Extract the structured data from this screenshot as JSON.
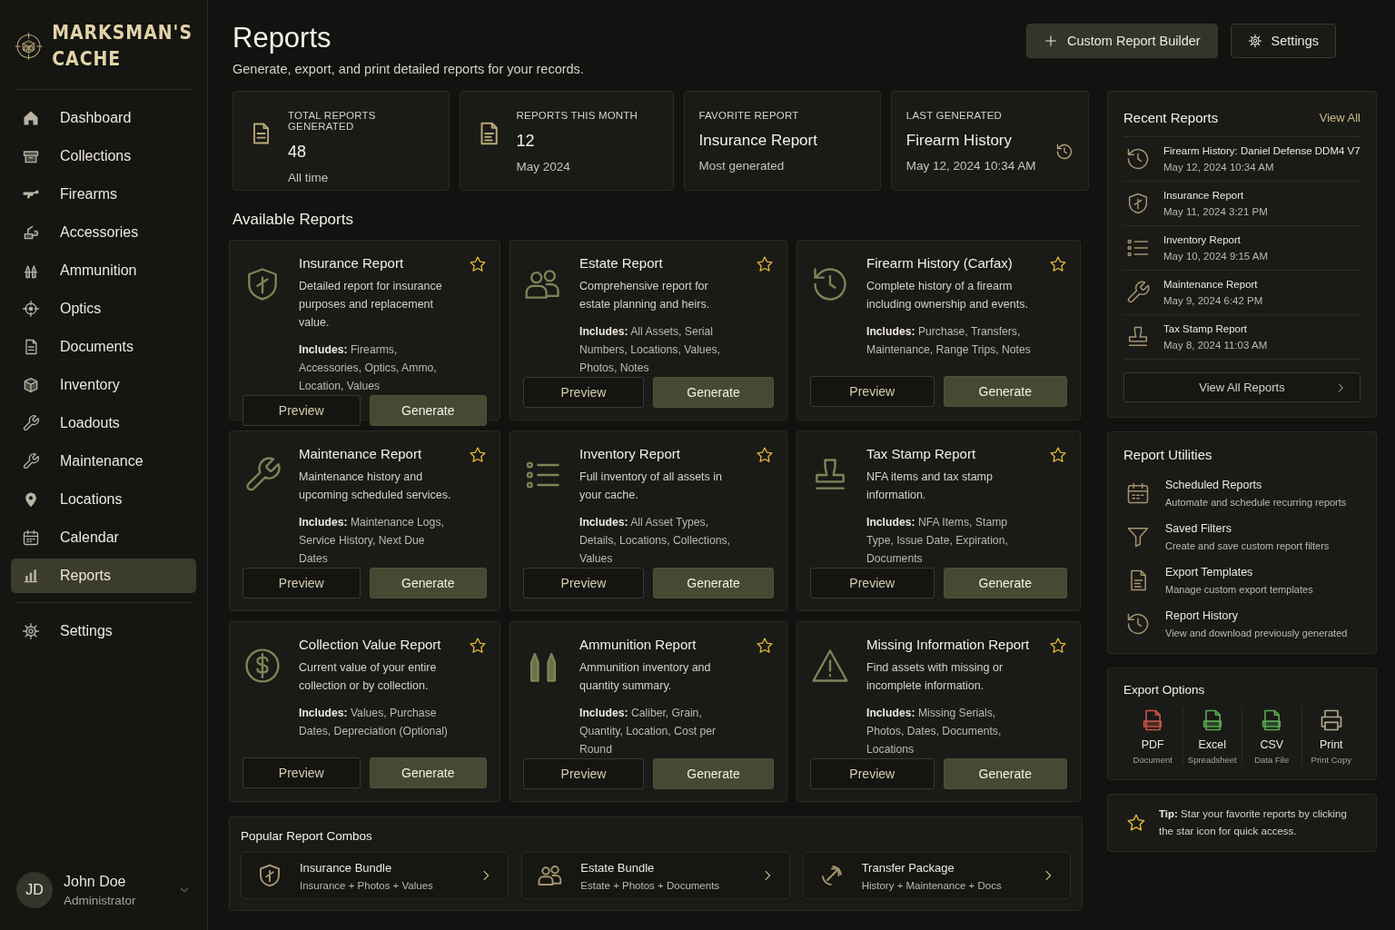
{
  "brand": {
    "line1": "MARKSMAN'S",
    "line2": "CACHE"
  },
  "nav": [
    {
      "label": "Dashboard",
      "selected": false
    },
    {
      "label": "Collections",
      "selected": false
    },
    {
      "label": "Firearms",
      "selected": false
    },
    {
      "label": "Accessories",
      "selected": false
    },
    {
      "label": "Ammunition",
      "selected": false
    },
    {
      "label": "Optics",
      "selected": false
    },
    {
      "label": "Documents",
      "selected": false
    },
    {
      "label": "Inventory",
      "selected": false
    },
    {
      "label": "Loadouts",
      "selected": false
    },
    {
      "label": "Maintenance",
      "selected": false
    },
    {
      "label": "Locations",
      "selected": false
    },
    {
      "label": "Calendar",
      "selected": false
    },
    {
      "label": "Reports",
      "selected": true
    }
  ],
  "nav_footer": [
    {
      "label": "Settings",
      "selected": false
    }
  ],
  "user": {
    "initials": "JD",
    "name": "John Doe",
    "role": "Administrator"
  },
  "header": {
    "title": "Reports",
    "subtitle": "Generate, export, and print detailed reports for your records.",
    "buttons": [
      "Custom Report Builder",
      "Settings"
    ]
  },
  "stats": [
    {
      "label": "TOTAL REPORTS GENERATED",
      "value": "48",
      "note": "All time"
    },
    {
      "label": "REPORTS THIS MONTH",
      "value": "12",
      "note": "May 2024"
    },
    {
      "label": "FAVORITE REPORT",
      "value": "Insurance Report",
      "note": "Most generated"
    },
    {
      "label": "LAST GENERATED",
      "value": "Firearm History",
      "note": "May 12, 2024 10:34 AM"
    }
  ],
  "available": {
    "title": "Available Reports",
    "reports": [
      {
        "title": "Insurance Report",
        "description": "Detailed report for insurance purposes and replacement value.",
        "includes": "**Includes:** Firearms, Accessories, Optics, Ammo, Location, Values",
        "actions": [
          "Preview",
          "Generate"
        ]
      },
      {
        "title": "Estate Report",
        "description": "Comprehensive report for estate planning and heirs.",
        "includes": "**Includes:** All Assets, Serial Numbers, Locations, Values, Photos, Notes",
        "actions": [
          "Preview",
          "Generate"
        ]
      },
      {
        "title": "Firearm History (Carfax)",
        "description": "Complete history of a firearm including ownership and events.",
        "includes": "**Includes:** Purchase, Transfers, Maintenance, Range Trips, Notes",
        "actions": [
          "Preview",
          "Generate"
        ]
      },
      {
        "title": "Maintenance Report",
        "description": "Maintenance history and upcoming scheduled services.",
        "includes": "**Includes:** Maintenance Logs, Service History, Next Due Dates",
        "actions": [
          "Preview",
          "Generate"
        ]
      },
      {
        "title": "Inventory Report",
        "description": "Full inventory of all assets in your cache.",
        "includes": "**Includes:** All Asset Types, Details, Locations, Collections, Values",
        "actions": [
          "Preview",
          "Generate"
        ]
      },
      {
        "title": "Tax Stamp Report",
        "description": "NFA items and tax stamp information.",
        "includes": "**Includes:** NFA Items, Stamp Type, Issue Date, Expiration, Documents",
        "actions": [
          "Preview",
          "Generate"
        ]
      },
      {
        "title": "Collection Value Report",
        "description": "Current value of your entire collection or by collection.",
        "includes": "**Includes:** Values, Purchase Dates, Depreciation (Optional)",
        "actions": [
          "Preview",
          "Generate"
        ]
      },
      {
        "title": "Ammunition Report",
        "description": "Ammunition inventory and quantity summary.",
        "includes": "**Includes:** Caliber, Grain, Quantity, Location, Cost per Round",
        "actions": [
          "Preview",
          "Generate"
        ]
      },
      {
        "title": "Missing Information Report",
        "description": "Find assets with missing or incomplete information.",
        "includes": "**Includes:** Missing Serials, Photos, Dates, Documents, Locations",
        "actions": [
          "Preview",
          "Generate"
        ]
      }
    ]
  },
  "combos": {
    "title": "Popular Report Combos",
    "items": [
      {
        "title": "Insurance Bundle",
        "subtitle": "Insurance + Photos + Values"
      },
      {
        "title": "Estate Bundle",
        "subtitle": "Estate + Photos + Documents"
      },
      {
        "title": "Transfer Package",
        "subtitle": "History + Maintenance + Docs"
      }
    ]
  },
  "recent": {
    "title": "Recent Reports",
    "link": "View All",
    "items": [
      {
        "title": "Firearm History: Daniel Defense DDM4 V7",
        "time": "May 12, 2024 10:34 AM"
      },
      {
        "title": "Insurance Report",
        "time": "May 11, 2024 3:21 PM"
      },
      {
        "title": "Inventory Report",
        "time": "May 10, 2024 9:15 AM"
      },
      {
        "title": "Maintenance Report",
        "time": "May 9, 2024 6:42 PM"
      },
      {
        "title": "Tax Stamp Report",
        "time": "May 8, 2024 11:03 AM"
      }
    ],
    "footer_button": "View All Reports"
  },
  "utilities": {
    "title": "Report Utilities",
    "items": [
      {
        "title": "Scheduled Reports",
        "description": "Automate and schedule recurring reports"
      },
      {
        "title": "Saved Filters",
        "description": "Create and save custom report filters"
      },
      {
        "title": "Export Templates",
        "description": "Manage custom export templates"
      },
      {
        "title": "Report History",
        "description": "View and download previously generated"
      }
    ]
  },
  "export": {
    "title": "Export Options",
    "items": [
      {
        "kind": "file",
        "format": "PDF",
        "note": "Document",
        "color": "#c4524a"
      },
      {
        "kind": "file",
        "format": "Excel",
        "note": "Spreadsheet",
        "color": "#5aa852"
      },
      {
        "kind": "file",
        "format": "CSV",
        "note": "Data File",
        "color": "#5aa852"
      },
      {
        "kind": "printer",
        "format": "Print",
        "note": "Print Copy",
        "color": "#b3a98f"
      }
    ]
  },
  "tip": "**Tip:** Star your favorite reports by clicking the star icon for quick access."
}
